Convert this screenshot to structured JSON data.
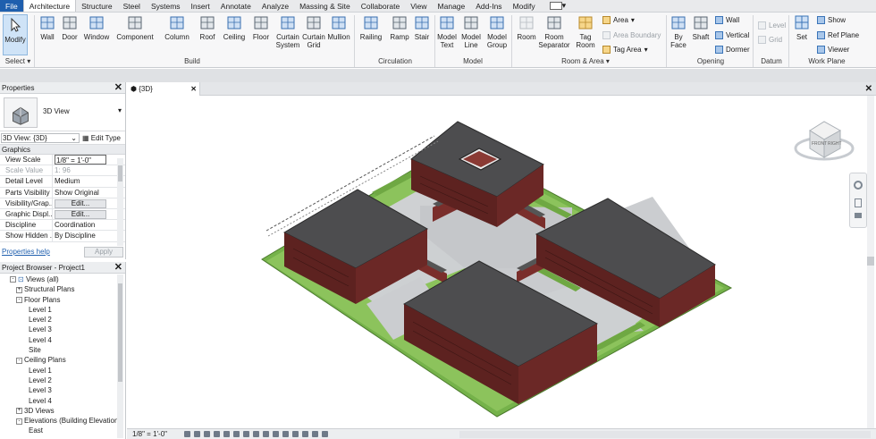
{
  "ribbon_tabs": [
    "File",
    "Architecture",
    "Structure",
    "Steel",
    "Systems",
    "Insert",
    "Annotate",
    "Analyze",
    "Massing & Site",
    "Collaborate",
    "View",
    "Manage",
    "Add-Ins",
    "Modify"
  ],
  "active_tab": "Architecture",
  "ribbon": {
    "select_label": "Select",
    "modify": "Modify",
    "build": {
      "label": "Build",
      "buttons": [
        "Wall",
        "Door",
        "Window",
        "Component",
        "Column",
        "Roof",
        "Ceiling",
        "Floor",
        "Curtain System",
        "Curtain Grid",
        "Mullion"
      ]
    },
    "circulation": {
      "label": "Circulation",
      "buttons": [
        "Railing",
        "Ramp",
        "Stair"
      ]
    },
    "model": {
      "label": "Model",
      "buttons": [
        "Model Text",
        "Model Line",
        "Model Group"
      ]
    },
    "room_area": {
      "label": "Room & Area",
      "buttons": [
        "Room",
        "Room Separator",
        "Tag Room"
      ],
      "small": [
        "Area",
        "Area Boundary",
        "Tag Area"
      ]
    },
    "opening": {
      "label": "Opening",
      "buttons": [
        "By Face",
        "Shaft"
      ],
      "small": [
        "Wall",
        "Vertical",
        "Dormer"
      ]
    },
    "datum": {
      "label": "Datum",
      "small": [
        "Level",
        "Grid"
      ]
    },
    "work_plane": {
      "label": "Work Plane",
      "buttons": [
        "Set"
      ],
      "small": [
        "Show",
        "Ref Plane",
        "Viewer"
      ]
    }
  },
  "properties": {
    "title": "Properties",
    "type_name": "3D View",
    "instance_selector": "3D View: {3D}",
    "edit_type": "Edit Type",
    "group": "Graphics",
    "rows": [
      {
        "k": "View Scale",
        "v": "1/8\" = 1'-0\""
      },
      {
        "k": "Scale Value",
        "v": "1: 96"
      },
      {
        "k": "Detail Level",
        "v": "Medium"
      },
      {
        "k": "Parts Visibility",
        "v": "Show Original"
      },
      {
        "k": "Visibility/Grap...",
        "v": "Edit..."
      },
      {
        "k": "Graphic Displ...",
        "v": "Edit..."
      },
      {
        "k": "Discipline",
        "v": "Coordination"
      },
      {
        "k": "Show Hidden ...",
        "v": "By Discipline"
      }
    ],
    "help": "Properties help",
    "apply": "Apply"
  },
  "project_browser": {
    "title": "Project Browser - Project1",
    "items": [
      {
        "label": "Views (all)",
        "indent": 1,
        "pm": "-"
      },
      {
        "label": "Structural Plans",
        "indent": 2,
        "pm": "+"
      },
      {
        "label": "Floor Plans",
        "indent": 2,
        "pm": "-"
      },
      {
        "label": "Level 1",
        "indent": 4,
        "pm": ""
      },
      {
        "label": "Level 2",
        "indent": 4,
        "pm": ""
      },
      {
        "label": "Level 3",
        "indent": 4,
        "pm": ""
      },
      {
        "label": "Level 4",
        "indent": 4,
        "pm": ""
      },
      {
        "label": "Site",
        "indent": 4,
        "pm": ""
      },
      {
        "label": "Ceiling Plans",
        "indent": 2,
        "pm": "-"
      },
      {
        "label": "Level 1",
        "indent": 4,
        "pm": ""
      },
      {
        "label": "Level 2",
        "indent": 4,
        "pm": ""
      },
      {
        "label": "Level 3",
        "indent": 4,
        "pm": ""
      },
      {
        "label": "Level 4",
        "indent": 4,
        "pm": ""
      },
      {
        "label": "3D Views",
        "indent": 2,
        "pm": "+"
      },
      {
        "label": "Elevations (Building Elevation)",
        "indent": 2,
        "pm": "-"
      },
      {
        "label": "East",
        "indent": 4,
        "pm": ""
      }
    ]
  },
  "view_tab": "{3D}",
  "status_scale": "1/8\" = 1'-0\"",
  "viewcube": {
    "faces": [
      "FRONT",
      "RIGHT"
    ]
  }
}
